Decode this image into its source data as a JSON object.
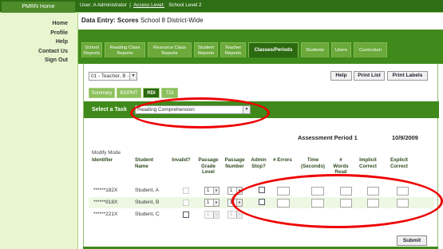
{
  "header": {
    "home_tab": "PMRN Home",
    "user_prefix": "User: A Administrator",
    "access_link": "Access Level:",
    "school_level": "School Level 2"
  },
  "leftnav": {
    "items": [
      {
        "label": "Home"
      },
      {
        "label": "Profile"
      },
      {
        "label": "Help"
      },
      {
        "label": "Contact Us"
      },
      {
        "label": "Sign Out"
      }
    ]
  },
  "page": {
    "title_bold": "Data Entry: Scores",
    "title_rest": "School 8 District-Wide"
  },
  "tabs": [
    {
      "line1": "School",
      "line2": "Reports"
    },
    {
      "line1": "Reading Class",
      "line2": "Reports"
    },
    {
      "line1": "Resource Class",
      "line2": "Reports"
    },
    {
      "line1": "Student",
      "line2": "Reports"
    },
    {
      "line1": "Teacher",
      "line2": "Reports"
    },
    {
      "line1": "Classes/Periods",
      "line2": ""
    },
    {
      "line1": "Students",
      "line2": ""
    },
    {
      "line1": "Users",
      "line2": ""
    },
    {
      "line1": "Curriculum",
      "line2": ""
    }
  ],
  "class_select": {
    "value": "01 - Teacher, B - U"
  },
  "buttons": {
    "help": "Help",
    "print_list": "Print List",
    "print_labels": "Print Labels",
    "submit": "Submit"
  },
  "subtabs": [
    "Summary",
    "BS/PMT",
    "RDI",
    "TDI"
  ],
  "task": {
    "label": "Select a Task",
    "value": "Reading Comprehension"
  },
  "assessment": {
    "period": "Assessment Period 1",
    "date": "10/9/2009"
  },
  "mode": "Modify Mode",
  "columns": [
    {
      "label": "Identifier"
    },
    {
      "label": "Student Name"
    },
    {
      "label": "Invalid?"
    },
    {
      "label": "Passage Grade Level"
    },
    {
      "label": "Passage Number"
    },
    {
      "label": "Admin Stop?"
    },
    {
      "label": "# Errors"
    },
    {
      "label": "Time (Seconds)"
    },
    {
      "label": "# Words Read"
    },
    {
      "label": "Implicit Correct"
    },
    {
      "label": "Explicit Correct"
    }
  ],
  "rows": [
    {
      "id": "******182X",
      "name": "Student, A",
      "grade": "1",
      "number": "1"
    },
    {
      "id": "******918X",
      "name": "Student, B",
      "grade": "1",
      "number": "1"
    },
    {
      "id": "******221X",
      "name": "Student, C",
      "grade": "1",
      "number": "1"
    }
  ],
  "colors": {
    "dark_green": "#3f8a1b",
    "light_green_bg": "#d9efb0",
    "annotation_red": "#ee0000"
  }
}
